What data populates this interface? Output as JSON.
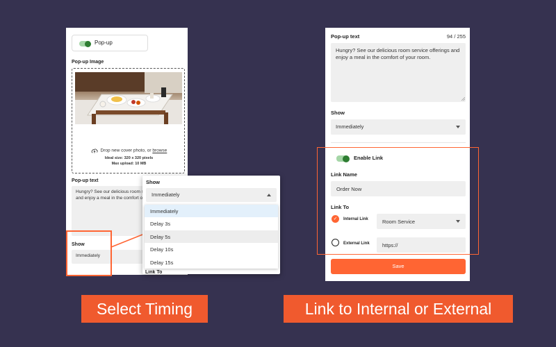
{
  "left_panel": {
    "popup_toggle": {
      "label": "Pop-up",
      "enabled": true
    },
    "image_label": "Pop-up Image",
    "dropzone": {
      "prompt": "Drop new cover photo, or",
      "browse": "browse",
      "ideal_size": "Ideal size: 320 x 320 pixels",
      "max_upload": "Max upload: 10 MB"
    },
    "text_label": "Pop-up text",
    "text_value": "Hungry? See our delicious room service offerings and enjoy a meal in the comfort of your room.",
    "show_label": "Show",
    "show_value": "Immediately"
  },
  "dropdown": {
    "label": "Show",
    "selected": "Immediately",
    "options": [
      "Immediately",
      "Delay 3s",
      "Delay 5s",
      "Delay 10s",
      "Delay 15s"
    ],
    "hovered": "Delay 5s",
    "behind_text": "Link To"
  },
  "right_panel": {
    "text_label": "Pop-up text",
    "char_count": "94 / 255",
    "text_value": "Hungry? See our delicious room service offerings and enjoy a meal in the comfort of your room.",
    "show_label": "Show",
    "show_value": "Immediately",
    "enable_link_label": "Enable Link",
    "enable_link": true,
    "link_name_label": "Link Name",
    "link_name_value": "Order Now",
    "link_to_label": "Link To",
    "internal_label": "Internal Link",
    "internal_value": "Room Service",
    "internal_selected": true,
    "external_label": "External Link",
    "external_value": "https://",
    "save_label": "Save"
  },
  "captions": {
    "left": "Select Timing",
    "right": "Link to Internal or External"
  },
  "colors": {
    "background": "#363250",
    "accent": "#ff6533",
    "toggle_on": "#2e7d32"
  }
}
